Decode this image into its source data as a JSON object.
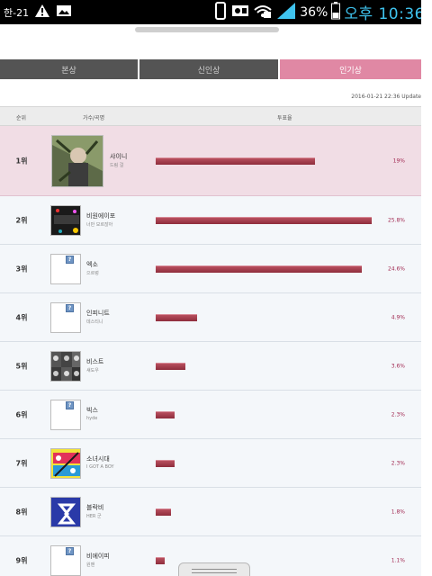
{
  "status_bar": {
    "carrier": "한-21",
    "battery_percent": "36%",
    "clock": "오후 10:36",
    "icons": [
      "butterfly-icon",
      "warning-icon",
      "gallery-icon",
      "phone-icon",
      "vcard-icon",
      "lock-icon",
      "wifi-icon",
      "signal-icon",
      "battery-icon"
    ],
    "clock_color": "#3fc3ee"
  },
  "tabs": [
    {
      "label": "본상",
      "active": false
    },
    {
      "label": "신인상",
      "active": false
    },
    {
      "label": "인기상",
      "active": true
    }
  ],
  "update_time": "2016-01-21 22:36 Update",
  "table": {
    "headers": {
      "rank": "순위",
      "artist": "가수/곡명",
      "votes": "투표율"
    },
    "rows": [
      {
        "rank": "1위",
        "name": "샤이니",
        "sub": "드림 걸",
        "percent": "19%",
        "share": 19,
        "thumb": "album"
      },
      {
        "rank": "2위",
        "name": "비원에이포",
        "sub": "너만 모르잖아",
        "percent": "25.8%",
        "share": 25.8,
        "thumb": "album"
      },
      {
        "rank": "3위",
        "name": "엑소",
        "sub": "으르렁",
        "percent": "24.6%",
        "share": 24.6,
        "thumb": "placeholder"
      },
      {
        "rank": "4위",
        "name": "인피니트",
        "sub": "데스티니",
        "percent": "4.9%",
        "share": 4.9,
        "thumb": "placeholder"
      },
      {
        "rank": "5위",
        "name": "비스트",
        "sub": "섀도우",
        "percent": "3.6%",
        "share": 3.6,
        "thumb": "photo"
      },
      {
        "rank": "6위",
        "name": "빅스",
        "sub": "hyde",
        "percent": "2.3%",
        "share": 2.3,
        "thumb": "placeholder"
      },
      {
        "rank": "7위",
        "name": "소녀시대",
        "sub": "I GOT A BOY",
        "percent": "2.3%",
        "share": 2.3,
        "thumb": "album"
      },
      {
        "rank": "8위",
        "name": "블락비",
        "sub": "HER 군",
        "percent": "1.8%",
        "share": 1.8,
        "thumb": "logo"
      },
      {
        "rank": "9위",
        "name": "비에이피",
        "sub": "원맨",
        "percent": "1.1%",
        "share": 1.1,
        "thumb": "placeholder"
      }
    ]
  },
  "colors": {
    "active_tab": "#e088a4",
    "inactive_tab": "#545454",
    "first_row_bg": "#f1dde5",
    "bar": "#a23e4e",
    "percent_text": "#a22b53"
  }
}
